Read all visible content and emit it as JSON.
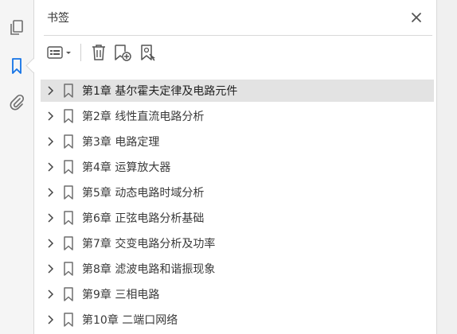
{
  "panel": {
    "title": "书签",
    "close_icon": "close-icon"
  },
  "rail": {
    "items": [
      {
        "icon": "page-thumbnails-icon"
      },
      {
        "icon": "bookmark-icon",
        "active": true
      },
      {
        "icon": "attachment-icon"
      }
    ]
  },
  "toolbar": {
    "options_icon": "bookmark-options-icon",
    "delete_icon": "trash-icon",
    "new_bookmark_icon": "new-bookmark-icon",
    "expand_bookmark_icon": "find-bookmark-icon"
  },
  "bookmarks": [
    {
      "label": "第1章  基尔霍夫定律及电路元件",
      "selected": true
    },
    {
      "label": "第2章  线性直流电路分析"
    },
    {
      "label": "第3章  电路定理"
    },
    {
      "label": "第4章  运算放大器"
    },
    {
      "label": "第5章  动态电路时域分析"
    },
    {
      "label": "第6章  正弦电路分析基础"
    },
    {
      "label": "第7章  交变电路分析及功率"
    },
    {
      "label": "第8章  滤波电路和谐振现象"
    },
    {
      "label": "第9章  三相电路"
    },
    {
      "label": "第10章  二端口网络"
    }
  ],
  "colors": {
    "selected_row": "#e3e3e3",
    "active_icon": "#1473e6",
    "icon": "#6e6e6e"
  }
}
